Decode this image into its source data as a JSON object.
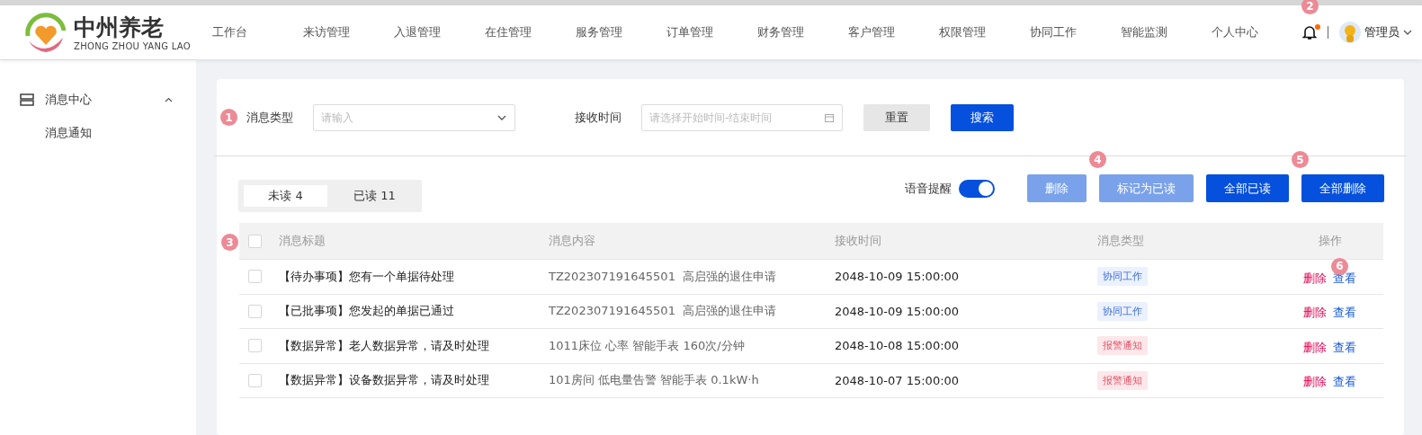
{
  "header": {
    "logo": {
      "title": "中州养老",
      "subtitle": "ZHONG ZHOU YANG LAO"
    },
    "nav": [
      {
        "label": "工作台"
      },
      {
        "label": "来访管理"
      },
      {
        "label": "入退管理"
      },
      {
        "label": "在住管理"
      },
      {
        "label": "服务管理"
      },
      {
        "label": "订单管理"
      },
      {
        "label": "财务管理"
      },
      {
        "label": "客户管理"
      },
      {
        "label": "权限管理"
      },
      {
        "label": "协同工作"
      },
      {
        "label": "智能监测"
      },
      {
        "label": "个人中心"
      }
    ],
    "notifications": {
      "annotation": "2",
      "unread_dot": true
    },
    "user": {
      "name": "管理员"
    }
  },
  "sidebar": {
    "items": [
      {
        "label": "消息中心",
        "expanded": true,
        "children": [
          {
            "label": "消息通知"
          }
        ]
      }
    ]
  },
  "search": {
    "annotation": "1",
    "fields": [
      {
        "kind": "select",
        "label": "消息类型",
        "placeholder": "请输入"
      },
      {
        "kind": "date",
        "label": "接收时间",
        "placeholder": "请选择开始时间-结束时间"
      }
    ],
    "buttons": [
      {
        "kind": "default",
        "label": "重置"
      },
      {
        "kind": "primary",
        "label": "搜索"
      }
    ]
  },
  "tabs": [
    {
      "label": "未读 4",
      "selected": true
    },
    {
      "label": "已读 11",
      "selected": false
    }
  ],
  "voice_reminder": {
    "label": "语音提醒",
    "on": true
  },
  "actions": [
    {
      "label": "删除",
      "disabled": true
    },
    {
      "label": "标记为已读",
      "disabled": true,
      "annotation": "4"
    },
    {
      "label": "全部已读",
      "disabled": false
    },
    {
      "label": "全部删除",
      "disabled": false,
      "annotation": "5"
    }
  ],
  "table": {
    "annotation": "3",
    "header_checked": false,
    "columns": [
      "消息标题",
      "消息内容",
      "接收时间",
      "消息类型",
      "操作"
    ],
    "rows": [
      {
        "checked": false,
        "title": "【待办事项】您有一个单据待处理",
        "content": "TZ202307191645501  高启强的退住申请",
        "time": "2048-10-09 15:00:00",
        "type": {
          "label": "协同工作",
          "kind": "cooperation",
          "color": "#ebf1fe"
        },
        "actions": [
          "删除",
          "查看"
        ],
        "annotation": "6"
      },
      {
        "checked": false,
        "title": "【已批事项】您发起的单据已通过",
        "content": "TZ202307191645501  高启强的退住申请",
        "time": "2048-10-09 15:00:00",
        "type": {
          "label": "协同工作",
          "kind": "cooperation",
          "color": "#ebf1fe"
        },
        "actions": [
          "删除",
          "查看"
        ]
      },
      {
        "checked": false,
        "title": "【数据异常】老人数据异常，请及时处理",
        "content": "1011床位 心率 智能手表 160次/分钟",
        "time": "2048-10-08 15:00:00",
        "type": {
          "label": "报警通知",
          "kind": "alarm",
          "color": "#fde7ea"
        },
        "actions": [
          "删除",
          "查看"
        ]
      },
      {
        "checked": false,
        "title": "【数据异常】设备数据异常，请及时处理",
        "content": "101房间 低电量告警 智能手表 0.1kW·h",
        "time": "2048-10-07 15:00:00",
        "type": {
          "label": "报警通知",
          "kind": "alarm",
          "color": "#fde7ea"
        },
        "actions": [
          "删除",
          "查看"
        ]
      }
    ]
  }
}
